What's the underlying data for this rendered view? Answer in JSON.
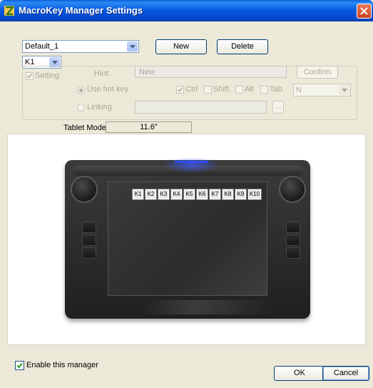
{
  "window": {
    "title": "MacroKey Manager Settings"
  },
  "profile": {
    "selected": "Default_1",
    "new_label": "New",
    "delete_label": "Delete"
  },
  "key_select": {
    "selected": "K1"
  },
  "settings": {
    "setting_label": "Setting",
    "setting_checked": true,
    "hint_label": "Hint:",
    "hint_value": "New",
    "confirm_label": "Confirm",
    "use_hot_key_label": "Use hot key",
    "use_hot_key_selected": true,
    "ctrl_label": "Ctrl",
    "ctrl_checked": true,
    "shift_label": "Shift",
    "alt_label": "Alt",
    "tab_label": "Tab",
    "key_value": "N",
    "linking_label": "Linking",
    "browse_label": "..."
  },
  "tablet": {
    "model_label": "Tablet Model:",
    "model_value": "11.6\"",
    "keys": [
      "K1",
      "K2",
      "K3",
      "K4",
      "K5",
      "K6",
      "K7",
      "K8",
      "K9",
      "K10"
    ]
  },
  "footer": {
    "enable_label": "Enable this manager",
    "enable_checked": true,
    "ok_label": "OK",
    "cancel_label": "Cancel"
  },
  "colors": {
    "titlebar": "#0558e0",
    "led": "#2d4dff",
    "window_bg": "#ece9d8"
  }
}
